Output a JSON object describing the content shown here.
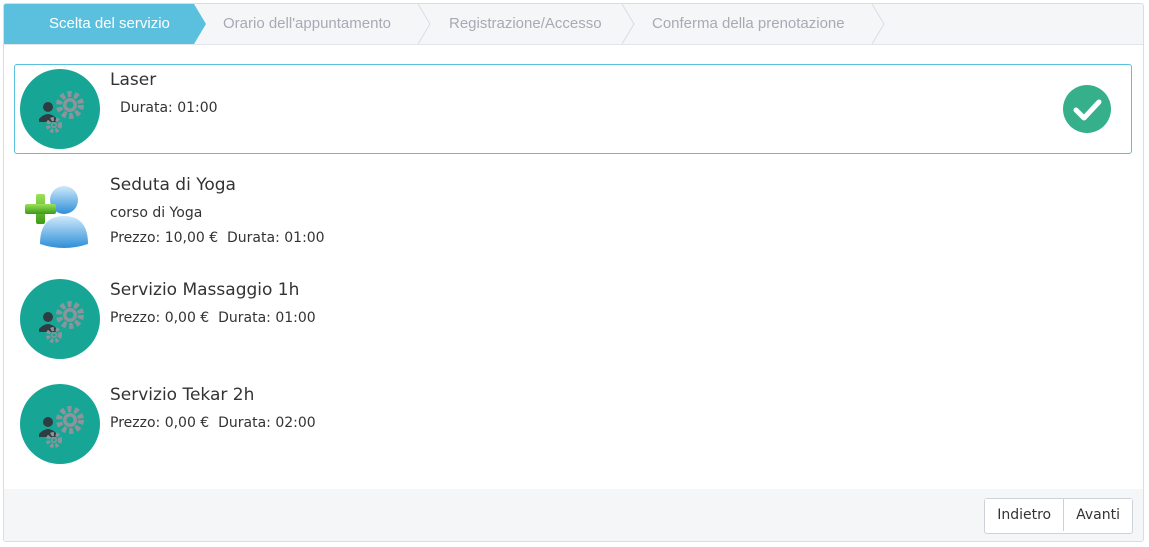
{
  "steps": [
    {
      "label": "Scelta del servizio",
      "active": true
    },
    {
      "label": "Orario dell'appuntamento",
      "active": false
    },
    {
      "label": "Registrazione/Accesso",
      "active": false
    },
    {
      "label": "Conferma della prenotazione",
      "active": false
    }
  ],
  "services": [
    {
      "name": "Laser",
      "description": "",
      "details": "Durata: 01:00",
      "icon": "gears-user-icon",
      "selected": true
    },
    {
      "name": "Seduta di Yoga",
      "description": "corso di Yoga",
      "details": "Prezzo: 10,00 €  Durata: 01:00",
      "icon": "user-add-icon",
      "selected": false
    },
    {
      "name": "Servizio Massaggio 1h",
      "description": "",
      "details": "Prezzo: 0,00 €  Durata: 01:00",
      "icon": "gears-user-icon",
      "selected": false
    },
    {
      "name": "Servizio Tekar 2h",
      "description": "",
      "details": "Prezzo: 0,00 €  Durata: 02:00",
      "icon": "gears-user-icon",
      "selected": false
    }
  ],
  "footer": {
    "back_label": "Indietro",
    "next_label": "Avanti"
  },
  "colors": {
    "accent": "#5bc0de",
    "teal": "#17a596",
    "check": "#35b08a"
  }
}
